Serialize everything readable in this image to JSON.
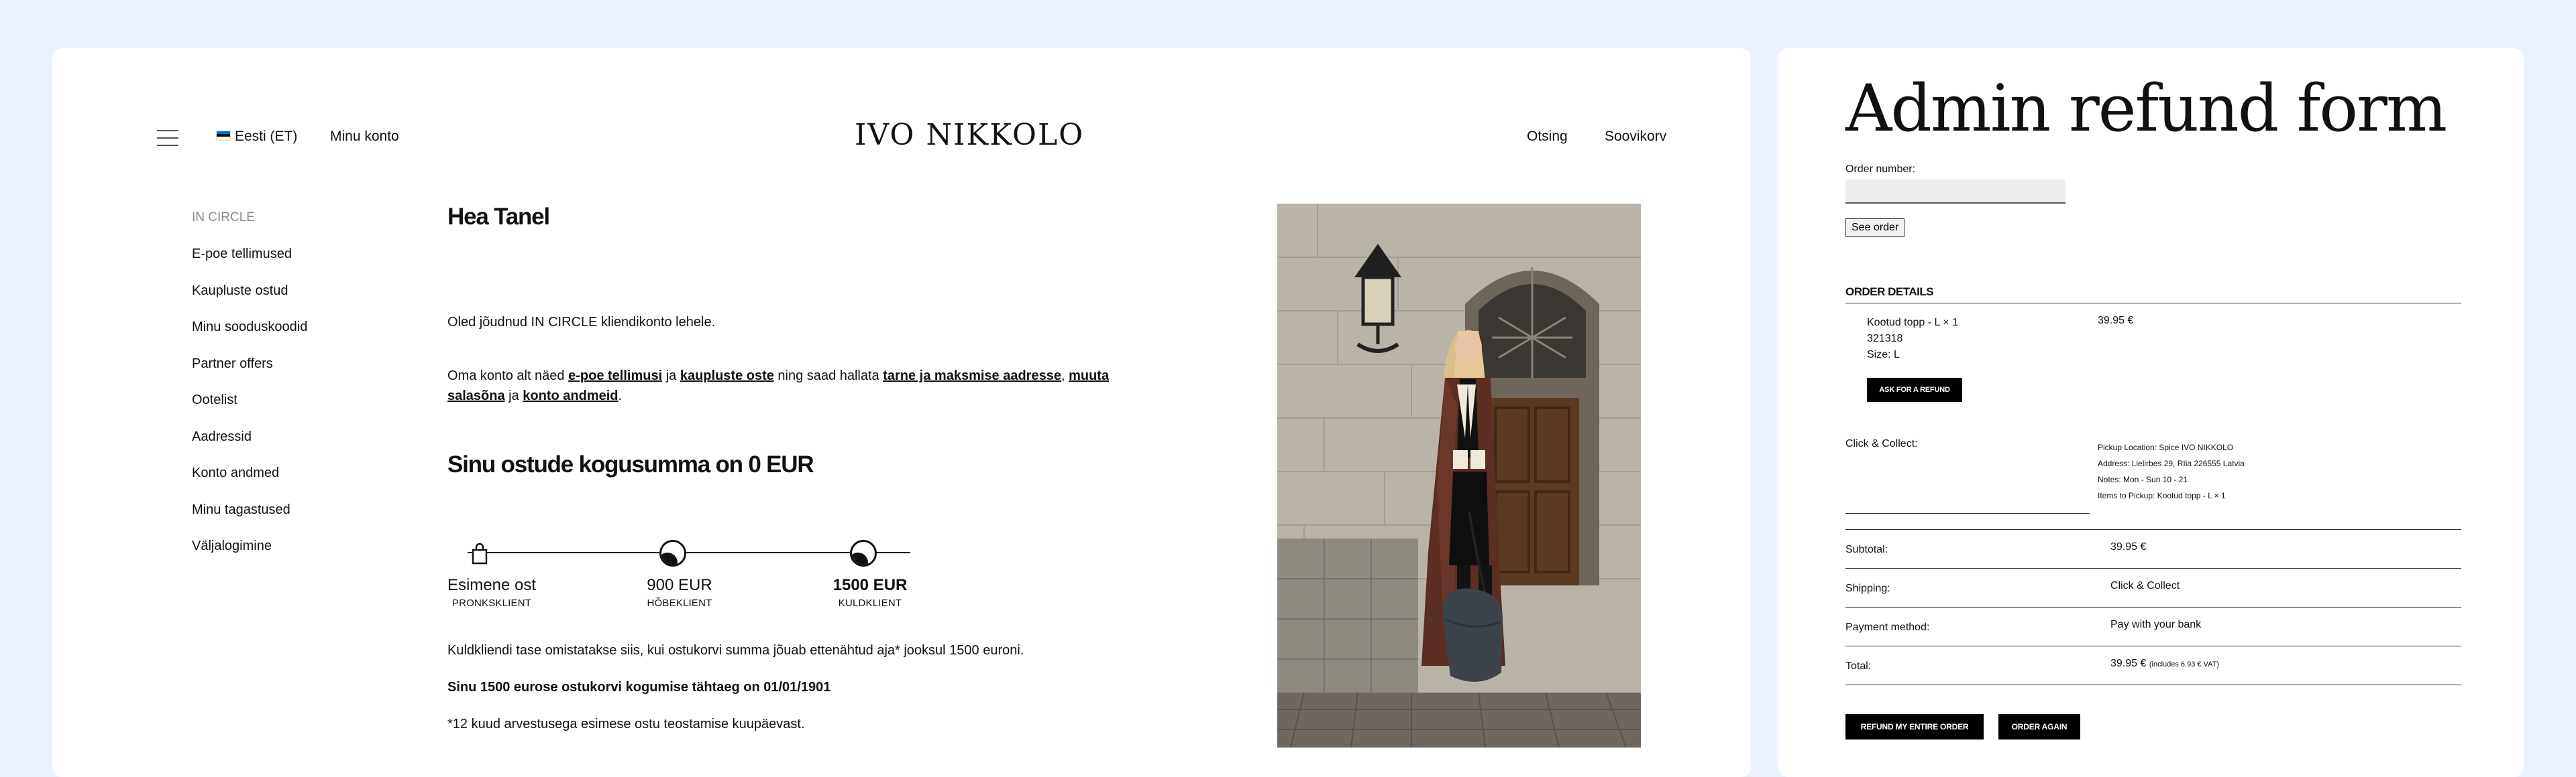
{
  "header": {
    "language": "Eesti (ET)",
    "my_account": "Minu konto",
    "logo": "IVO NIKKOLO",
    "search": "Otsing",
    "wishlist": "Soovikorv"
  },
  "sidebar": {
    "section_title": "IN CIRCLE",
    "items": [
      {
        "label": "E-poe tellimused"
      },
      {
        "label": "Kaupluste ostud"
      },
      {
        "label": "Minu sooduskoodid"
      },
      {
        "label": "Partner offers"
      },
      {
        "label": "Ootelist"
      },
      {
        "label": "Aadressid"
      },
      {
        "label": "Konto andmed"
      },
      {
        "label": "Minu tagastused"
      },
      {
        "label": "Väljalogimine"
      }
    ]
  },
  "main": {
    "greeting": "Hea Tanel",
    "welcome": "Oled jõudnud IN CIRCLE kliendikonto lehele.",
    "intro": {
      "t1": "Oma konto alt näed ",
      "l1": "e-poe tellimusi",
      "t2": " ja ",
      "l2": "kaupluste oste",
      "t3": " ning saad hallata ",
      "l3": "tarne ja maksmise aadresse",
      "t4": ", ",
      "l4": "muuta salasõna",
      "t5": " ja ",
      "l5": "konto andmeid",
      "t6": "."
    },
    "total_heading": "Sinu ostude kogusumma on 0 EUR",
    "tiers": [
      {
        "amount": "Esimene ost",
        "label": "PRONKSKLIENT"
      },
      {
        "amount": "900 EUR",
        "label": "HÕBEKLIENT"
      },
      {
        "amount": "1500 EUR",
        "label": "KULDKLIENT"
      }
    ],
    "note1": "Kuldkliendi tase omistatakse siis, kui ostukorvi summa jõuab ettenähtud aja* jooksul 1500 euroni.",
    "note2": "Sinu 1500 eurose ostukorvi kogumise tähtaeg on 01/01/1901",
    "note3": "*12 kuud arvestusega esimese ostu teostamise kuupäevast."
  },
  "admin": {
    "title": "Admin refund form",
    "order_number_label": "Order number:",
    "order_number_value": "",
    "see_order": "See order",
    "order_details_title": "ORDER DETAILS",
    "product": {
      "name": "Kootud topp - L × 1",
      "sku": "321318",
      "size": "Size: L",
      "price": "39.95 €",
      "refund_button": "ASK FOR A REFUND"
    },
    "click_collect": {
      "label": "Click & Collect:",
      "pickup": "Pickup Location: Spice IVO NIKKOLO",
      "address": "Address: Lielirbes 29, Rīia 226555 Latvia",
      "notes": "Notes: Mon - Sun 10 - 21",
      "items": "Items to Pickup: Kootud topp - L × 1"
    },
    "summary": [
      {
        "label": "Subtotal:",
        "value": "39.95 €",
        "extra": ""
      },
      {
        "label": "Shipping:",
        "value": "Click & Collect",
        "extra": ""
      },
      {
        "label": "Payment method:",
        "value": "Pay with your bank",
        "extra": ""
      },
      {
        "label": "Total:",
        "value": "39.95 €",
        "extra": "(includes 6.93 € VAT)"
      }
    ],
    "refund_all": "REFUND MY ENTIRE ORDER",
    "order_again": "ORDER AGAIN"
  }
}
